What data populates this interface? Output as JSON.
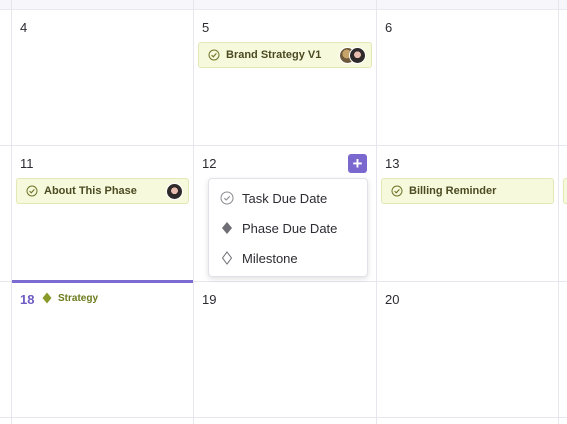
{
  "calendar": {
    "days": [
      {
        "num": "4"
      },
      {
        "num": "5"
      },
      {
        "num": "6"
      },
      {
        "num": "11"
      },
      {
        "num": "12"
      },
      {
        "num": "13"
      },
      {
        "num": "18"
      },
      {
        "num": "19"
      },
      {
        "num": "20"
      }
    ]
  },
  "events": {
    "brand_strategy": "Brand Strategy V1",
    "about_phase": "About This Phase",
    "billing_reminder": "Billing Reminder",
    "strategy_phase": "Strategy"
  },
  "add_menu": {
    "plus": "+",
    "items": [
      {
        "label": "Task Due Date",
        "icon": "check-circle-icon"
      },
      {
        "label": "Phase Due Date",
        "icon": "diamond-filled-icon"
      },
      {
        "label": "Milestone",
        "icon": "diamond-outline-icon"
      }
    ]
  },
  "colors": {
    "accent": "#7b68cf",
    "event_bg": "#f7f9dc",
    "phase_green": "#8a9a2a"
  }
}
